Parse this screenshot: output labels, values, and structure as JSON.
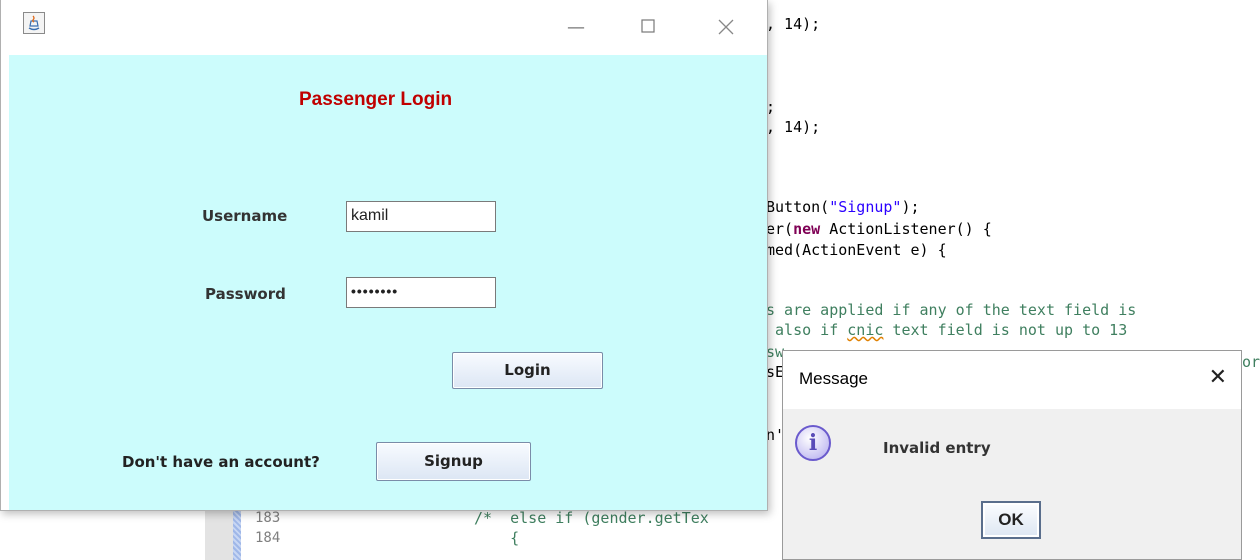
{
  "editor": {
    "code_lines_right": [
      ", 14);",
      ";",
      ", 14);",
      "Button(\"Signup\");",
      "er(new ActionListener() {",
      "med(ActionEvent e) {",
      "s are applied if any of the text field is",
      " also if cnic text field is not up to 13",
      "sw",
      "sE",
      "n'"
    ],
    "line_numbers": [
      "183",
      "184"
    ],
    "code_left_183": "/*  else if (gender.getTex",
    "code_left_184": "    {",
    "fragment_or": "or"
  },
  "login_window": {
    "title": "Passenger Login",
    "username_label": "Username",
    "username_value": "kamil",
    "password_label": "Password",
    "password_value": "••••••••",
    "login_label": "Login",
    "no_account_label": "Don't have an account?",
    "signup_label": "Signup"
  },
  "message_dialog": {
    "title": "Message",
    "message": "Invalid entry",
    "ok_label": "OK",
    "icon": "info-icon"
  }
}
